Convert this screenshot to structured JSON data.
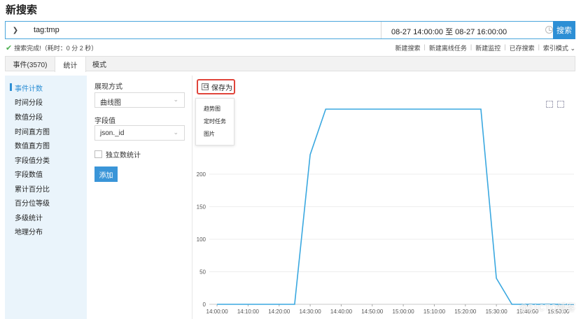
{
  "page": {
    "title": "新搜索"
  },
  "search": {
    "query": "tag:tmp",
    "time_range": "08-27 14:00:00 至 08-27 16:00:00",
    "button_label": "搜索"
  },
  "status": {
    "text": "搜索完成!（耗时：0 分 2 秒）"
  },
  "actions": [
    "新建搜索",
    "新建离线任务",
    "新建监控",
    "已存搜索",
    "索引模式"
  ],
  "tabs": [
    {
      "label": "事件(3570)"
    },
    {
      "label": "统计"
    },
    {
      "label": "模式"
    }
  ],
  "sidebar": {
    "items": [
      "事件计数",
      "时间分段",
      "数值分段",
      "时间直方图",
      "数值直方图",
      "字段值分类",
      "字段数值",
      "累计百分比",
      "百分位等级",
      "多级统计",
      "地理分布"
    ],
    "active_index": 0
  },
  "config": {
    "display_label": "展现方式",
    "display_value": "曲线图",
    "field_label": "字段值",
    "field_value": "json._id",
    "distinct_label": "独立数统计",
    "add_button": "添加"
  },
  "save_as": {
    "label": "保存为",
    "menu": [
      "趋势图",
      "定时任务",
      "图片"
    ]
  },
  "colors": {
    "accent": "#2d8fd5",
    "line": "#3aa8e0",
    "highlight": "#e0453b"
  },
  "watermark": "@51CTO博客",
  "chart_data": {
    "type": "line",
    "x": [
      "14:00:00",
      "14:05:00",
      "14:10:00",
      "14:15:00",
      "14:20:00",
      "14:25:00",
      "14:30:00",
      "14:35:00",
      "14:40:00",
      "14:45:00",
      "14:50:00",
      "14:55:00",
      "15:00:00",
      "15:05:00",
      "15:10:00",
      "15:15:00",
      "15:20:00",
      "15:25:00",
      "15:30:00",
      "15:35:00",
      "15:40:00",
      "15:45:00",
      "15:50:00",
      "15:55:00"
    ],
    "xticks": [
      "14:00:00",
      "14:10:00",
      "14:20:00",
      "14:30:00",
      "14:40:00",
      "14:50:00",
      "15:00:00",
      "15:10:00",
      "15:20:00",
      "15:30:00",
      "15:40:00",
      "15:50:00"
    ],
    "series": [
      {
        "values": [
          0,
          0,
          0,
          0,
          0,
          0,
          230,
          300,
          300,
          300,
          300,
          300,
          300,
          300,
          300,
          300,
          300,
          300,
          40,
          0,
          0,
          0,
          0,
          0
        ]
      }
    ],
    "yticks": [
      0,
      50,
      100,
      150,
      200
    ],
    "ylim": [
      0,
      310
    ],
    "grid": true,
    "title": "",
    "xlabel": "",
    "ylabel": ""
  }
}
